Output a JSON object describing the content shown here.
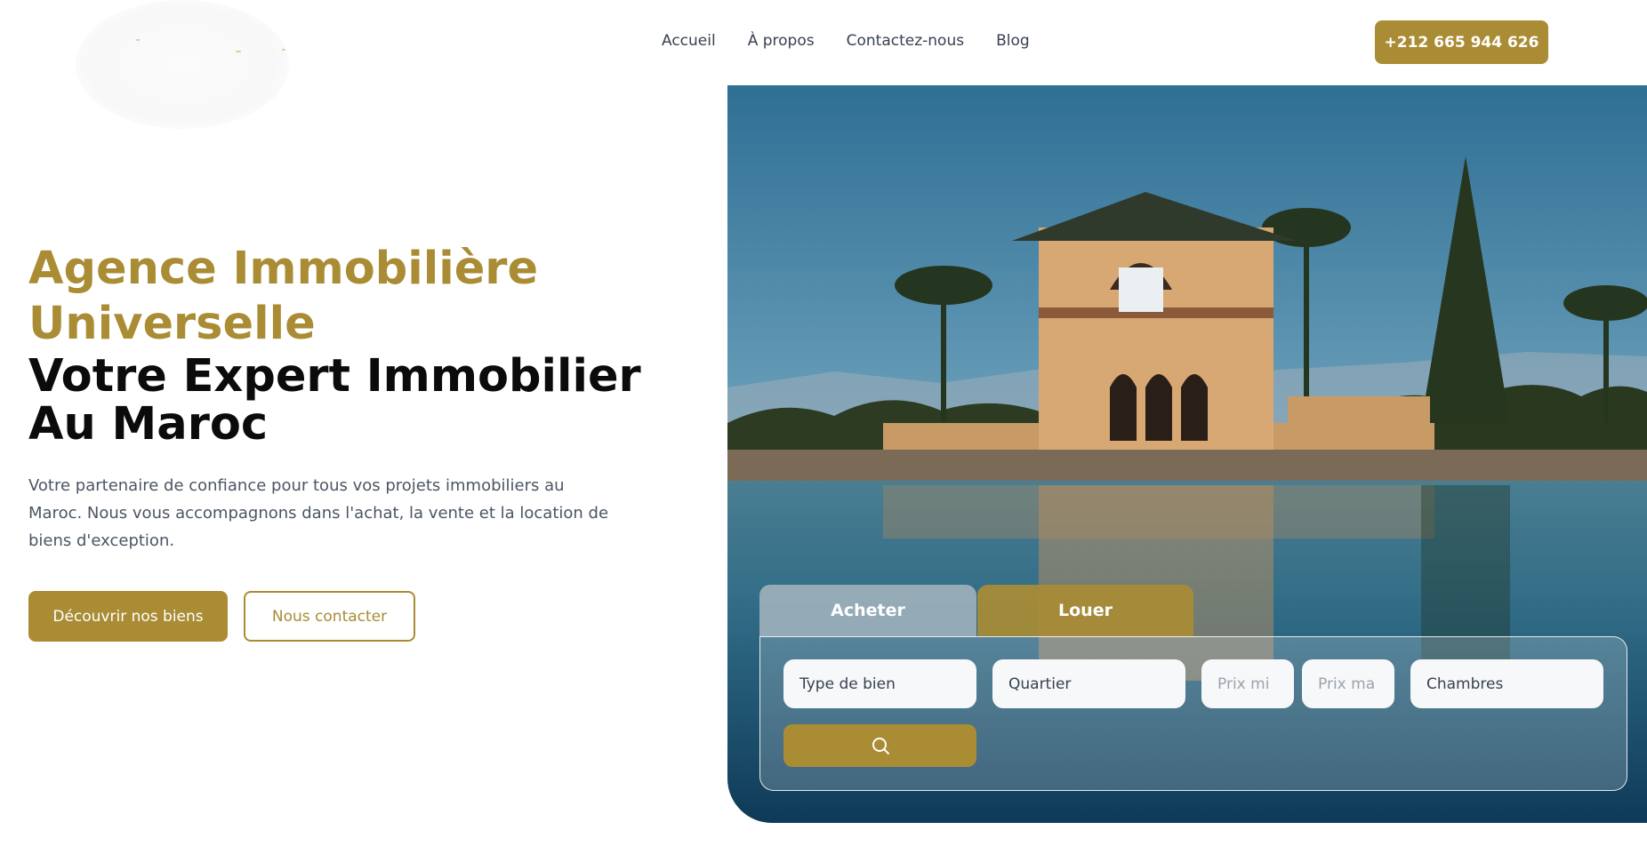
{
  "header": {
    "nav": [
      "Accueil",
      "À propos",
      "Contactez-nous",
      "Blog"
    ],
    "phone": "+212 665 944 626"
  },
  "hero": {
    "title": "Agence Immobilière Universelle",
    "subtitle": "Votre Expert Immobilier Au Maroc",
    "description": "Votre partenaire de confiance pour tous vos projets immobiliers au Maroc. Nous vous accompagnons dans l'achat, la vente et la location de biens d'exception.",
    "cta_primary": "Découvrir nos biens",
    "cta_secondary": "Nous contacter"
  },
  "search": {
    "tabs": [
      "Acheter",
      "Louer"
    ],
    "fields": {
      "type": "Type de bien",
      "district": "Quartier",
      "price_min": "Prix mi",
      "price_max": "Prix ma",
      "bedrooms": "Chambres"
    }
  },
  "colors": {
    "accent": "#a98c34",
    "heading": "#0b0b0b",
    "text": "#4b5563"
  },
  "icons": [
    "search-icon"
  ]
}
